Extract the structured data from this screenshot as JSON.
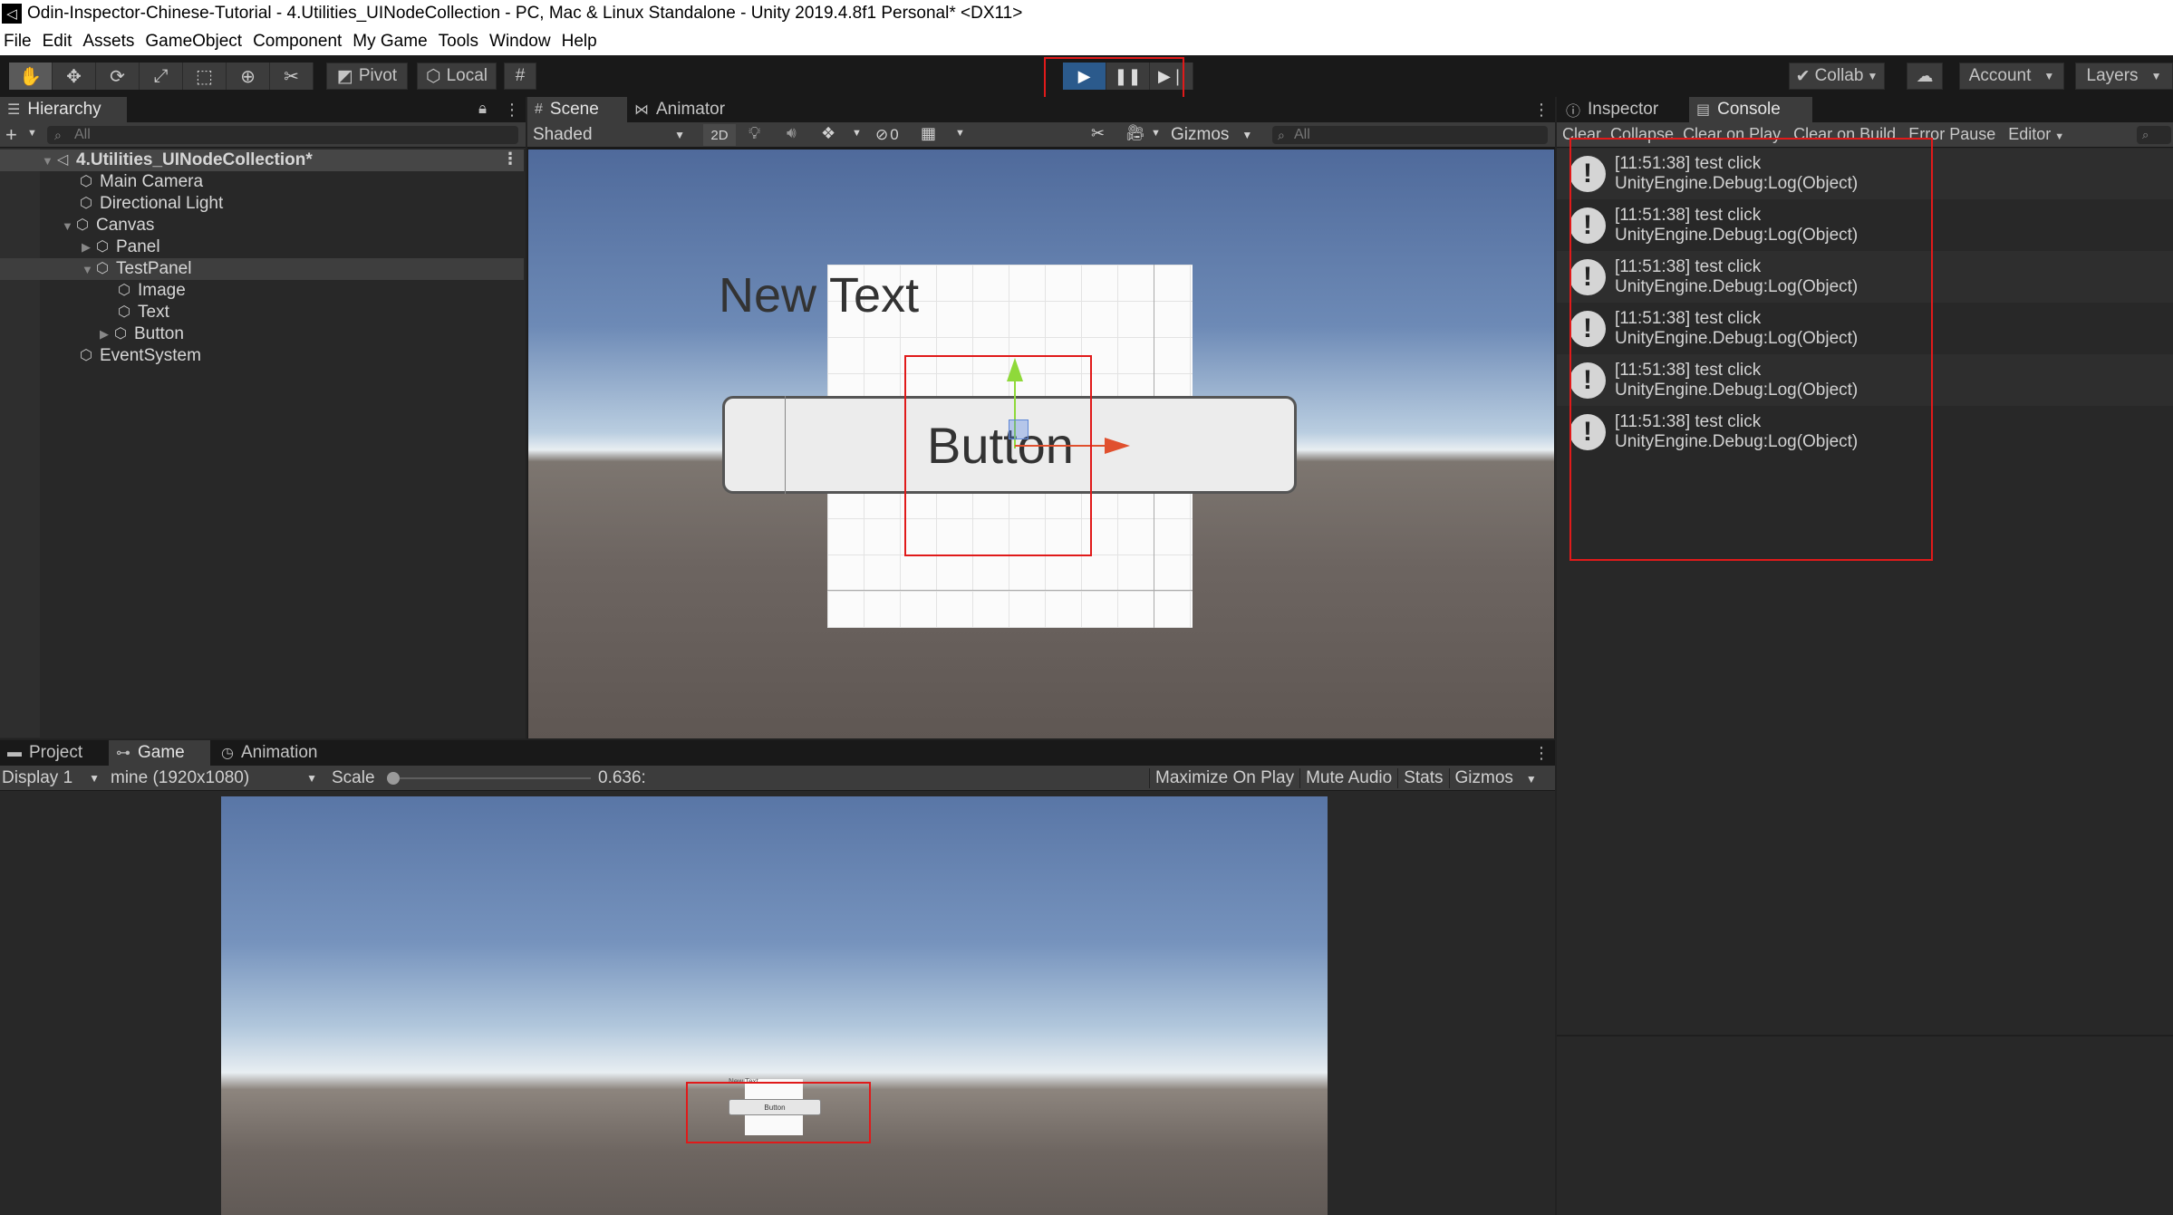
{
  "window": {
    "title": "Odin-Inspector-Chinese-Tutorial - 4.Utilities_UINodeCollection - PC, Mac & Linux Standalone - Unity 2019.4.8f1 Personal* <DX11>"
  },
  "menu": [
    "File",
    "Edit",
    "Assets",
    "GameObject",
    "Component",
    "My Game",
    "Tools",
    "Window",
    "Help"
  ],
  "toolbar": {
    "pivot_label": "Pivot",
    "local_label": "Local",
    "collab_label": "Collab",
    "account_label": "Account",
    "layers_label": "Layers"
  },
  "hierarchy": {
    "tab_label": "Hierarchy",
    "search_placeholder": "All",
    "scene_name": "4.Utilities_UINodeCollection*",
    "items": [
      {
        "label": "Main Camera"
      },
      {
        "label": "Directional Light"
      },
      {
        "label": "Canvas"
      },
      {
        "label": "Panel"
      },
      {
        "label": "TestPanel"
      },
      {
        "label": "Image"
      },
      {
        "label": "Text"
      },
      {
        "label": "Button"
      },
      {
        "label": "EventSystem"
      }
    ]
  },
  "scene": {
    "tab_scene": "Scene",
    "tab_animator": "Animator",
    "shading_mode": "Shaded",
    "mode_2d": "2D",
    "hidden_count": "0",
    "gizmos_label": "Gizmos",
    "search_placeholder": "All",
    "canvas_text": "New Text",
    "canvas_button": "Button"
  },
  "inspector": {
    "tab_inspector": "Inspector",
    "tab_console": "Console",
    "console_buttons": [
      "Clear",
      "Collapse",
      "Clear on Play",
      "Clear on Build",
      "Error Pause",
      "Editor"
    ],
    "logs": [
      {
        "line1": "[11:51:38] test click",
        "line2": "UnityEngine.Debug:Log(Object)"
      },
      {
        "line1": "[11:51:38] test click",
        "line2": "UnityEngine.Debug:Log(Object)"
      },
      {
        "line1": "[11:51:38] test click",
        "line2": "UnityEngine.Debug:Log(Object)"
      },
      {
        "line1": "[11:51:38] test click",
        "line2": "UnityEngine.Debug:Log(Object)"
      },
      {
        "line1": "[11:51:38] test click",
        "line2": "UnityEngine.Debug:Log(Object)"
      },
      {
        "line1": "[11:51:38] test click",
        "line2": "UnityEngine.Debug:Log(Object)"
      }
    ]
  },
  "game": {
    "tab_project": "Project",
    "tab_game": "Game",
    "tab_animation": "Animation",
    "display": "Display 1",
    "resolution": "mine (1920x1080)",
    "scale_label": "Scale",
    "scale_value": "0.636:",
    "scale_fraction": 0.01,
    "maximize_on_play": "Maximize On Play",
    "mute_audio": "Mute Audio",
    "stats": "Stats",
    "gizmos": "Gizmos",
    "mini_text": "New Text",
    "mini_button": "Button"
  }
}
